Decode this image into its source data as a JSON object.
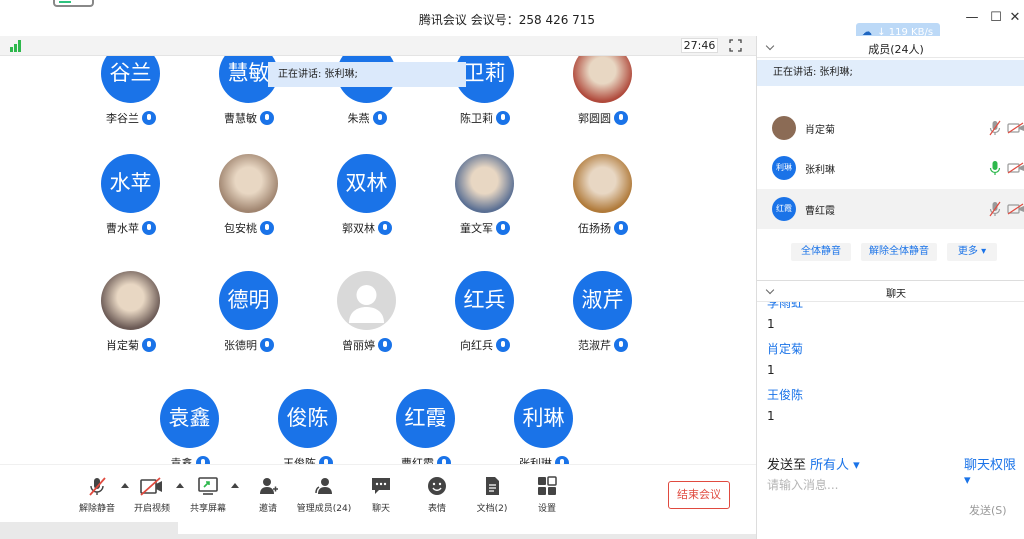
{
  "window": {
    "title": "腾讯会议 会议号：258 426 715",
    "speed": "119 KB/s",
    "minimize": "—",
    "maximize": "☐",
    "close": "✕"
  },
  "video_bar": {
    "timer": "27:46"
  },
  "gallery": {
    "speaking_banner": "正在讲话: 张利琳;",
    "participants": [
      {
        "avatar": "谷兰",
        "name": "李谷兰",
        "type": "text"
      },
      {
        "avatar": "慧敏",
        "name": "曹慧敏",
        "type": "text"
      },
      {
        "avatar": "燕",
        "name": "朱燕",
        "type": "text"
      },
      {
        "avatar": "卫莉",
        "name": "陈卫莉",
        "type": "text"
      },
      {
        "avatar": "",
        "name": "郭圆圆",
        "type": "photo"
      },
      {
        "avatar": "水苹",
        "name": "曹水苹",
        "type": "text"
      },
      {
        "avatar": "",
        "name": "包安桃",
        "type": "photo"
      },
      {
        "avatar": "双林",
        "name": "郭双林",
        "type": "text"
      },
      {
        "avatar": "",
        "name": "童文军",
        "type": "photo"
      },
      {
        "avatar": "",
        "name": "伍扬扬",
        "type": "photo"
      },
      {
        "avatar": "",
        "name": "肖定菊",
        "type": "photo"
      },
      {
        "avatar": "德明",
        "name": "张德明",
        "type": "text"
      },
      {
        "avatar": "",
        "name": "曾丽婷",
        "type": "gray"
      },
      {
        "avatar": "红兵",
        "name": "向红兵",
        "type": "text"
      },
      {
        "avatar": "淑芹",
        "name": "范淑芹",
        "type": "text"
      },
      {
        "avatar": "袁鑫",
        "name": "袁鑫",
        "type": "text"
      },
      {
        "avatar": "俊陈",
        "name": "王俊陈",
        "type": "text"
      },
      {
        "avatar": "红霞",
        "name": "曹红霞",
        "type": "text"
      },
      {
        "avatar": "利琳",
        "name": "张利琳",
        "type": "text"
      }
    ]
  },
  "toolbar": {
    "unmute": "解除静音",
    "start_video": "开启视频",
    "share_screen": "共享屏幕",
    "invite": "邀请",
    "manage_members": "管理成员(24)",
    "chat": "聊天",
    "emoji": "表情",
    "documents": "文档(2)",
    "settings": "设置",
    "end_meeting": "结束会议"
  },
  "members_panel": {
    "title": "成员(24人)",
    "speaking": "正在讲话: 张利琳;",
    "members": [
      {
        "avatar": "",
        "name": "肖定菊",
        "type": "photo",
        "mic": "muted"
      },
      {
        "avatar": "利琳",
        "name": "张利琳",
        "type": "text",
        "mic": "speaking"
      },
      {
        "avatar": "红霞",
        "name": "曹红霞",
        "type": "text",
        "mic": "muted"
      }
    ],
    "mute_all": "全体静音",
    "unmute_all": "解除全体静音",
    "more": "更多 ▾"
  },
  "chat_panel": {
    "title": "聊天",
    "messages": [
      {
        "sender": "李雨虹",
        "text": "1"
      },
      {
        "sender": "肖定菊",
        "text": "1"
      },
      {
        "sender": "王俊陈",
        "text": "1"
      }
    ],
    "send_to_label": "发送至",
    "send_to_value": "所有人 ▾",
    "permission": "聊天权限 ▾",
    "input_placeholder": "请输入消息...",
    "send": "发送(S)"
  },
  "colors": {
    "accent": "#1a73e8",
    "danger": "#e04a3f",
    "speaking": "#2db84c"
  }
}
